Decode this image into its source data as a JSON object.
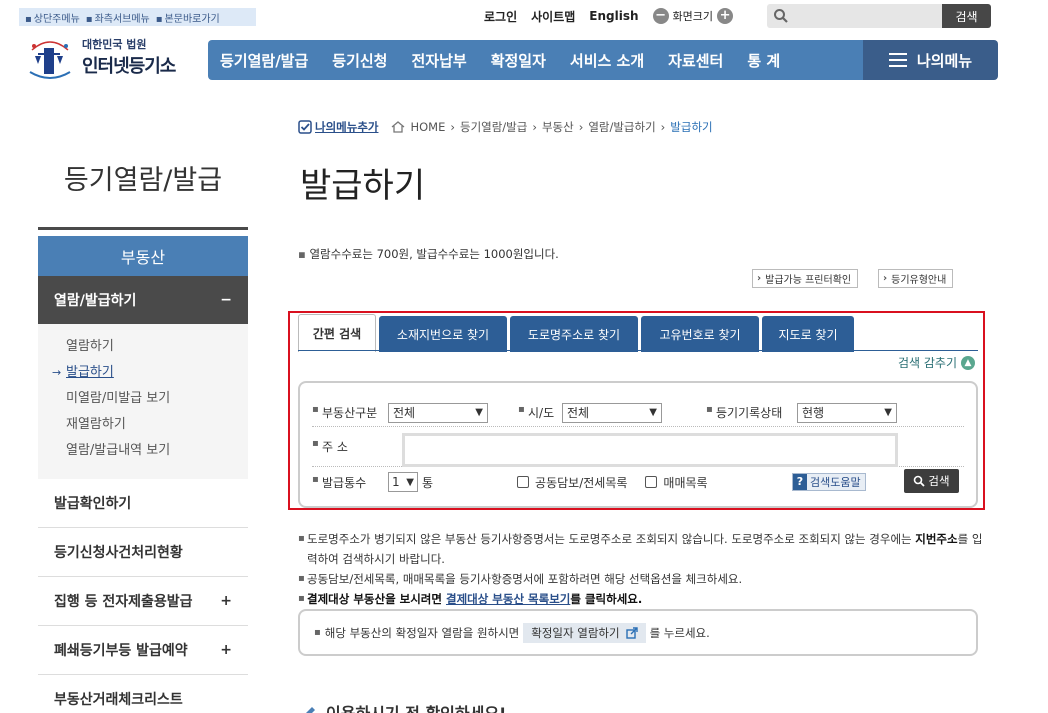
{
  "skip_links": [
    "상단주메뉴",
    "좌측서브메뉴",
    "본문바로가기"
  ],
  "utility": {
    "login": "로그인",
    "sitemap": "사이트맵",
    "english": "English",
    "zoom": "화면크기",
    "zoom_out": "−",
    "zoom_in": "+"
  },
  "top_search": {
    "button": "검색",
    "placeholder": ""
  },
  "logo": {
    "line1": "대한민국 법원",
    "line2": "인터넷등기소"
  },
  "gnb": [
    "등기열람/발급",
    "등기신청",
    "전자납부",
    "확정일자",
    "서비스 소개",
    "자료센터",
    "통 계"
  ],
  "my_menu": "나의메뉴",
  "lnb": {
    "title": "등기열람/발급",
    "head": "부동산",
    "active": {
      "label": "열람/발급하기",
      "toggle": "−"
    },
    "sub": [
      "열람하기",
      "발급하기",
      "미열람/미발급 보기",
      "재열람하기",
      "열람/발급내역 보기"
    ],
    "items": [
      {
        "label": "발급확인하기",
        "toggle": ""
      },
      {
        "label": "등기신청사건처리현황",
        "toggle": ""
      },
      {
        "label": "집행 등 전자제출용발급",
        "toggle": "+"
      },
      {
        "label": "폐쇄등기부등 발급예약",
        "toggle": "+"
      },
      {
        "label": "부동산거래체크리스트",
        "toggle": ""
      }
    ]
  },
  "breadcrumb": {
    "fav": "나의메뉴추가",
    "items": [
      "HOME",
      "등기열람/발급",
      "부동산",
      "열람/발급하기"
    ],
    "current": "발급하기"
  },
  "page_title": "발급하기",
  "fee_note": "열람수수료는 700원, 발급수수료는 1000원입니다.",
  "side_buttons": [
    "발급가능 프린터확인",
    "등기유형안내"
  ],
  "tabs": [
    "간편 검색",
    "소재지번으로 찾기",
    "도로명주소로 찾기",
    "고유번호로 찾기",
    "지도로 찾기"
  ],
  "fold": "검색 감추기",
  "form": {
    "type_label": "부동산구분",
    "type_value": "전체",
    "sido_label": "시/도",
    "sido_value": "전체",
    "status_label": "등기기록상태",
    "status_value": "현행",
    "addr_label": "주 소",
    "count_label": "발급통수",
    "count_value": "1",
    "count_unit": "통",
    "check1": "공동담보/전세목록",
    "check2": "매매목록",
    "help": "검색도움말",
    "search": "검색"
  },
  "notes": {
    "n1a": "도로명주소가 병기되지 않은 부동산 등기사항증명서는 도로명주소로 조회되지 않습니다. 도로명주소로 조회되지 않는 경우에는 ",
    "n1b": "지번주소",
    "n1c": "를 입력하여 검색하시기 바랍니다.",
    "n2": "공동담보/전세목록, 매매목록을 등기사항증명서에 포함하려면 해당 선택옵션을 체크하세요.",
    "n3a": "결제대상 부동산을 보시려면 ",
    "n3b": "결제대상 부동산 목록보기",
    "n3c": "를 클릭하세요."
  },
  "box2": {
    "pre": "해당 부동산의 확정일자 열람을 원하시면",
    "btn": "확정일자 열람하기",
    "post": "를 누르세요."
  },
  "cutoff_heading": "이용하시기 전 확인하세요!"
}
